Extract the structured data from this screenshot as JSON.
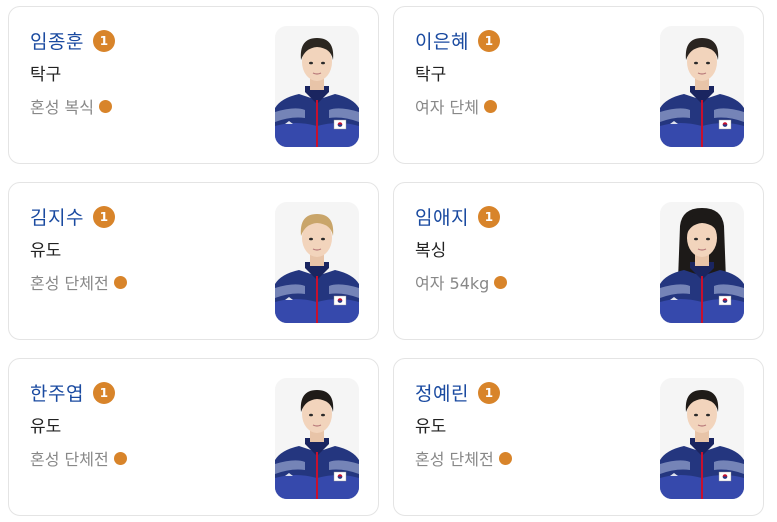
{
  "athletes": [
    {
      "name": "임종훈",
      "medal_count": "1",
      "sport": "탁구",
      "event": "혼성 복식",
      "medal_color": "#d8842a",
      "hair": "#2b2620",
      "long_hair": false
    },
    {
      "name": "이은혜",
      "medal_count": "1",
      "sport": "탁구",
      "event": "여자 단체",
      "medal_color": "#d8842a",
      "hair": "#2a2420",
      "long_hair": false
    },
    {
      "name": "김지수",
      "medal_count": "1",
      "sport": "유도",
      "event": "혼성 단체전",
      "medal_color": "#d8842a",
      "hair": "#c9a56a",
      "long_hair": false
    },
    {
      "name": "임애지",
      "medal_count": "1",
      "sport": "복싱",
      "event": "여자 54kg",
      "medal_color": "#d8842a",
      "hair": "#1d1a18",
      "long_hair": true
    },
    {
      "name": "한주엽",
      "medal_count": "1",
      "sport": "유도",
      "event": "혼성 단체전",
      "medal_color": "#d8842a",
      "hair": "#1f1b18",
      "long_hair": false
    },
    {
      "name": "정예린",
      "medal_count": "1",
      "sport": "유도",
      "event": "혼성 단체전",
      "medal_color": "#d8842a",
      "hair": "#1f1b18",
      "long_hair": false
    }
  ]
}
